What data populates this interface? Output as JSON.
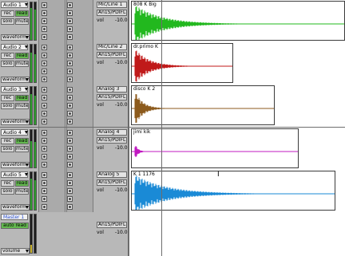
{
  "tracks": [
    {
      "name": "Audio 1",
      "rec": "rec",
      "read": "read",
      "solo": "solo",
      "mute": "mute",
      "view": "waveform",
      "input": "Mic/Line 1",
      "output": "An1S/PDIFL",
      "vol_label": "vol",
      "vol_value": "-10.0",
      "clip_title": "808 K Big",
      "wave_color": "#22b81e",
      "meter": 0.85
    },
    {
      "name": "Audio 2",
      "rec": "rec",
      "read": "read",
      "solo": "solo",
      "mute": "mute",
      "view": "waveform",
      "input": "Mic/Line 2",
      "output": "An1S/PDIFL",
      "vol_label": "vol",
      "vol_value": "-10.0",
      "clip_title": "dr.primo K",
      "wave_color": "#c01a1a",
      "meter": 0.78
    },
    {
      "name": "Audio 3",
      "rec": "rec",
      "read": "read",
      "solo": "solo",
      "mute": "mute",
      "view": "waveform",
      "input": "Analog 3",
      "output": "An1S/PDIFL",
      "vol_label": "vol",
      "vol_value": "-10.0",
      "clip_title": "disco K 2",
      "wave_color": "#8c5a1c",
      "meter": 0.8
    },
    {
      "name": "Audio 4",
      "rec": "rec",
      "read": "read",
      "solo": "solo",
      "mute": "mute",
      "view": "waveform",
      "input": "Analog 4",
      "output": "An1S/PDIFL",
      "vol_label": "vol",
      "vol_value": "-10.0",
      "clip_title": "jimi kik",
      "wave_color": "#c018c0",
      "meter": 0.7
    },
    {
      "name": "Audio 5",
      "rec": "rec",
      "read": "read",
      "solo": "solo",
      "mute": "mute",
      "view": "waveform",
      "input": "Analog 5",
      "output": "An1S/PDIFL",
      "vol_label": "vol",
      "vol_value": "-10.0",
      "clip_title": "K 1 1176",
      "wave_color": "#1a8ad6",
      "meter": 0.82
    }
  ],
  "master": {
    "name": "Master 1",
    "auto": "auto read",
    "output": "An1S/PDIFL",
    "vol_label": "vol",
    "vol_value": "-10.0",
    "view": "volume"
  },
  "colors": {
    "green_button": "#63b84f",
    "meter": "#2e9f2e"
  },
  "icons": {
    "dropdown": "dropdown-arrow-icon",
    "insert": "insert-slot-icon"
  }
}
